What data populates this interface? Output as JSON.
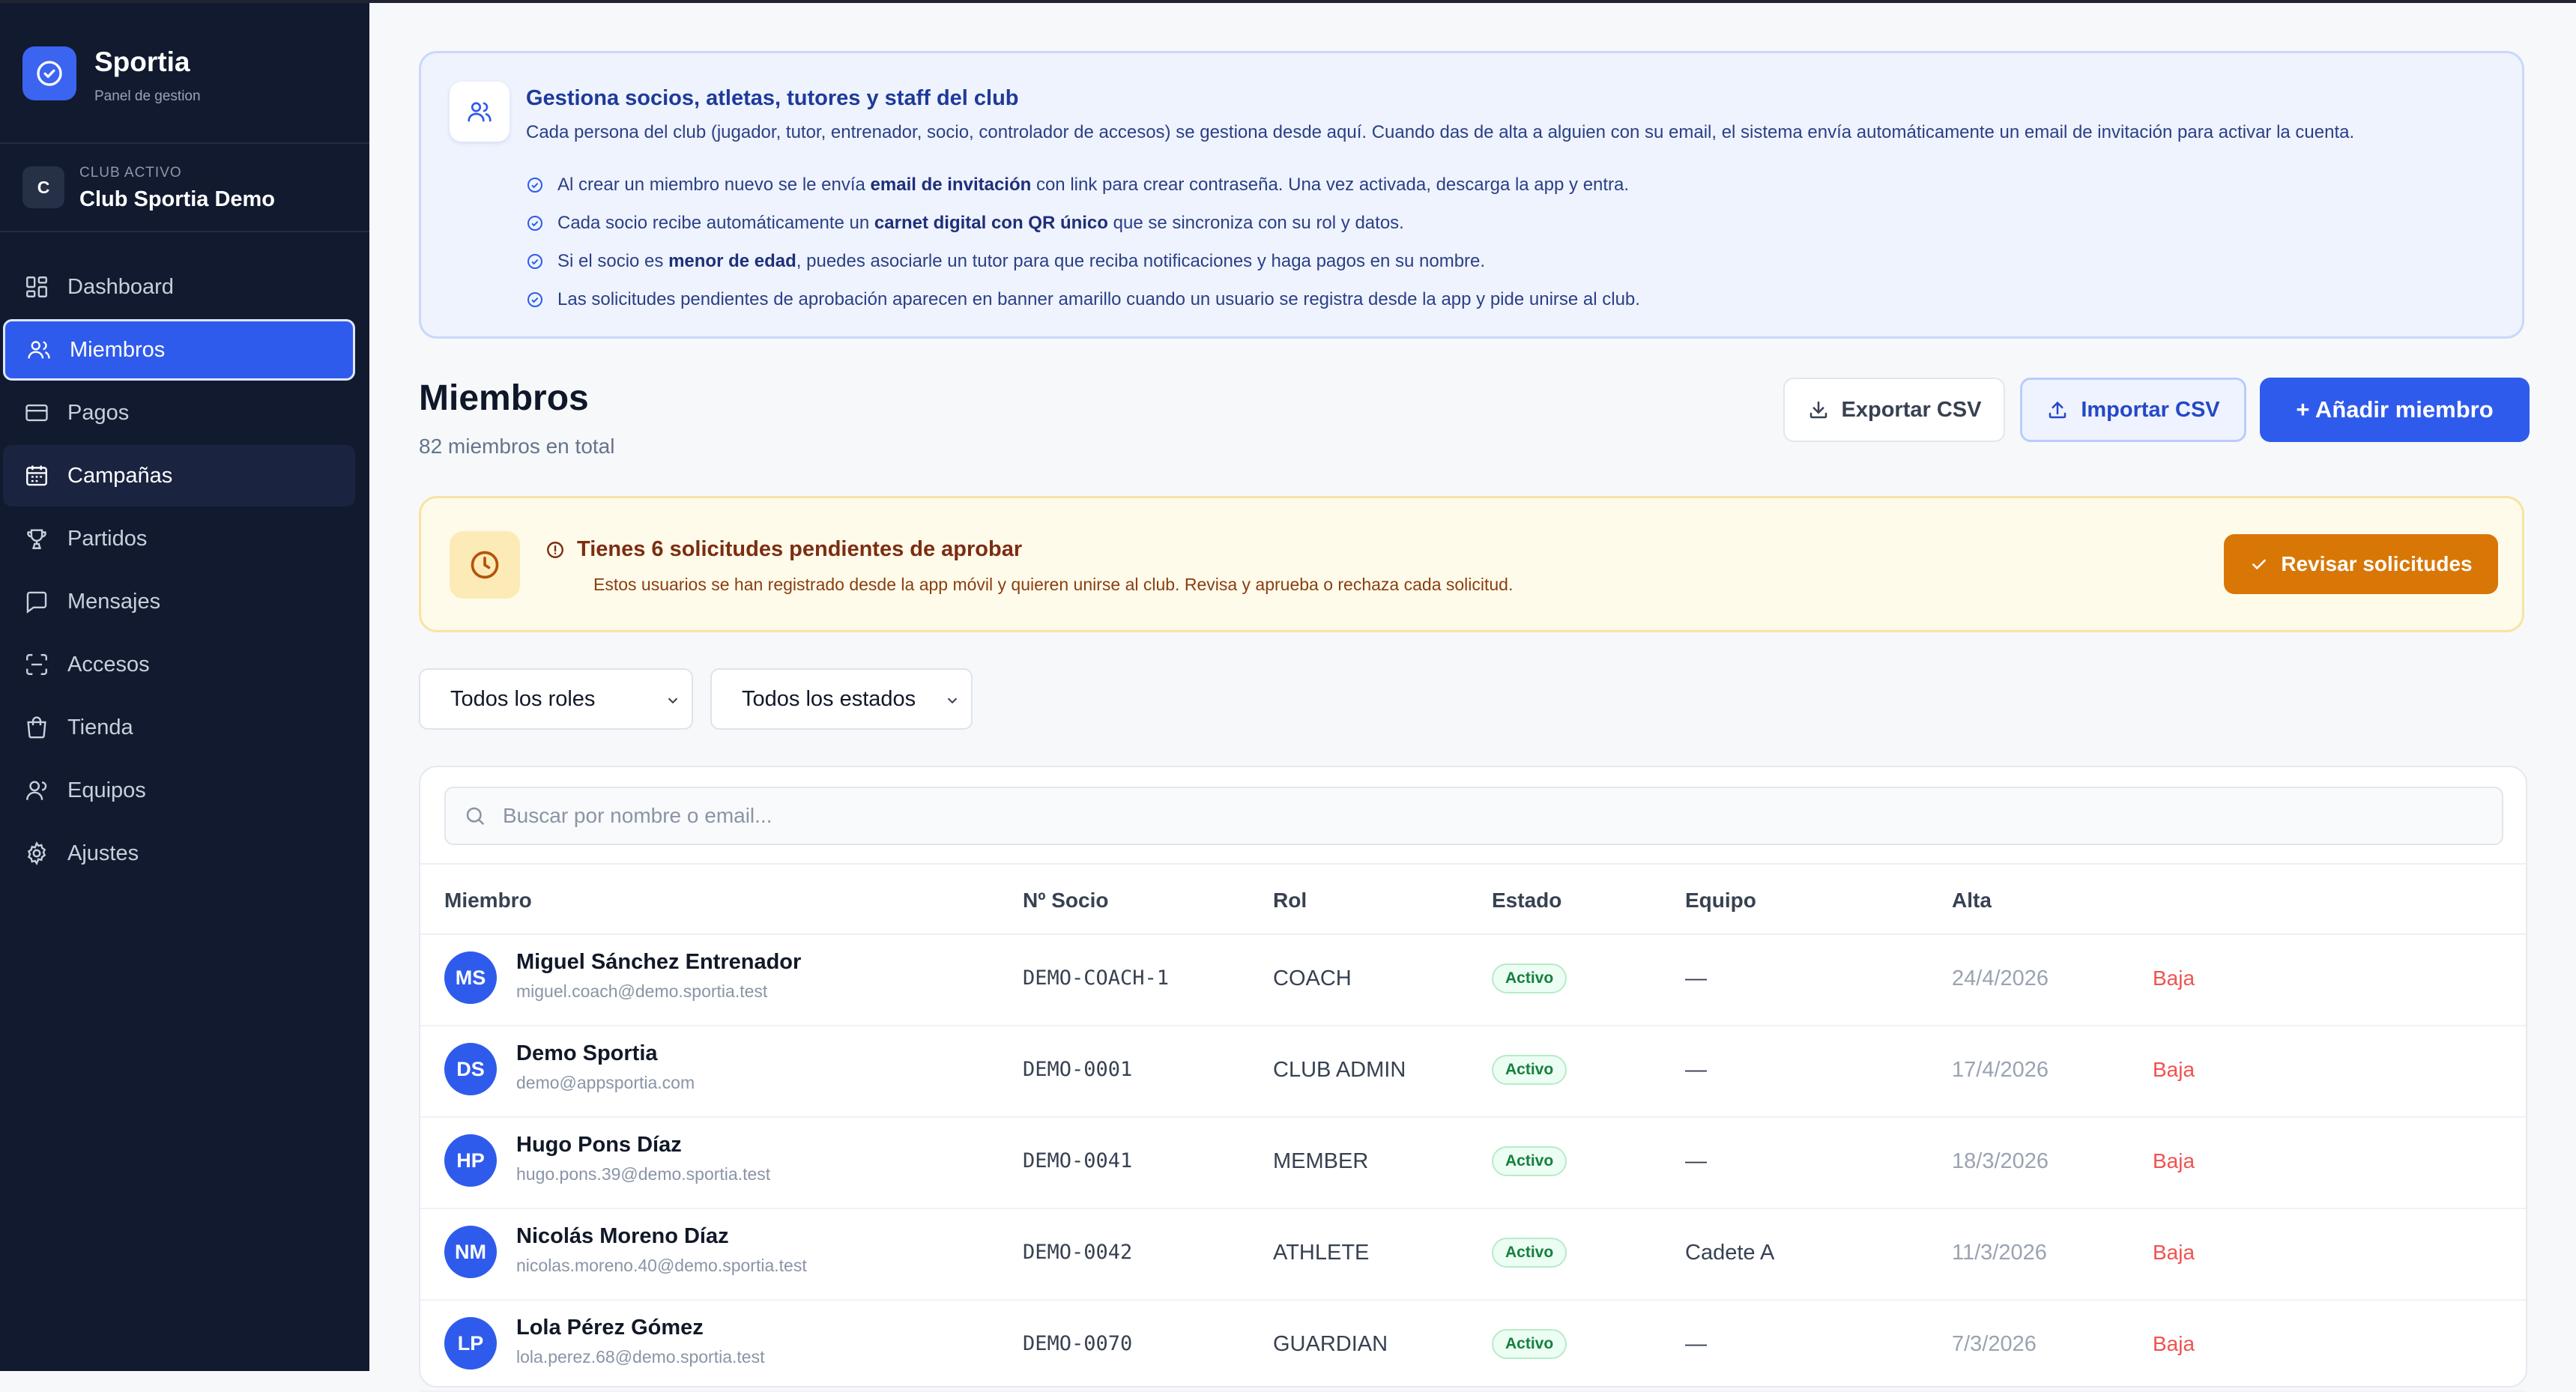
{
  "sidebar": {
    "brand": {
      "name": "Sportia",
      "subtitle": "Panel de gestion"
    },
    "club": {
      "badge": "C",
      "label": "CLUB ACTIVO",
      "name": "Club Sportia Demo"
    },
    "items": [
      {
        "label": "Dashboard",
        "icon": "dashboard-icon",
        "state": "normal"
      },
      {
        "label": "Miembros",
        "icon": "users-icon",
        "state": "active"
      },
      {
        "label": "Pagos",
        "icon": "credit-card-icon",
        "state": "normal"
      },
      {
        "label": "Campañas",
        "icon": "calendar-icon",
        "state": "hover"
      },
      {
        "label": "Partidos",
        "icon": "trophy-icon",
        "state": "normal"
      },
      {
        "label": "Mensajes",
        "icon": "message-icon",
        "state": "normal"
      },
      {
        "label": "Accesos",
        "icon": "scan-icon",
        "state": "normal"
      },
      {
        "label": "Tienda",
        "icon": "shopping-bag-icon",
        "state": "normal"
      },
      {
        "label": "Equipos",
        "icon": "user-icon",
        "state": "normal"
      },
      {
        "label": "Ajustes",
        "icon": "gear-icon",
        "state": "normal"
      }
    ]
  },
  "info": {
    "title": "Gestiona socios, atletas, tutores y staff del club",
    "description": "Cada persona del club (jugador, tutor, entrenador, socio, controlador de accesos) se gestiona desde aquí. Cuando das de alta a alguien con su email, el sistema envía automáticamente un email de invitación para activar la cuenta.",
    "items": [
      {
        "before": "Al crear un miembro nuevo se le envía ",
        "bold": "email de invitación",
        "after": " con link para crear contraseña. Una vez activada, descarga la app y entra."
      },
      {
        "before": "Cada socio recibe automáticamente un ",
        "bold": "carnet digital con QR único",
        "after": " que se sincroniza con su rol y datos."
      },
      {
        "before": "Si el socio es ",
        "bold": "menor de edad",
        "after": ", puedes asociarle un tutor para que reciba notificaciones y haga pagos en su nombre."
      },
      {
        "before": "Las solicitudes pendientes de aprobación aparecen en banner amarillo cuando un usuario se registra desde la app y pide unirse al club.",
        "bold": "",
        "after": ""
      }
    ]
  },
  "header": {
    "title": "Miembros",
    "subtitle": "82 miembros en total",
    "export_label": "Exportar CSV",
    "import_label": "Importar CSV",
    "add_label": "+ Añadir miembro"
  },
  "pending": {
    "title": "Tienes 6 solicitudes pendientes de aprobar",
    "description": "Estos usuarios se han registrado desde la app móvil y quieren unirse al club. Revisa y aprueba o rechaza cada solicitud.",
    "button_label": "Revisar solicitudes"
  },
  "filters": {
    "roles": "Todos los roles",
    "states": "Todos los estados"
  },
  "search": {
    "placeholder": "Buscar por nombre o email..."
  },
  "table": {
    "columns": [
      "Miembro",
      "Nº Socio",
      "Rol",
      "Estado",
      "Equipo",
      "Alta"
    ],
    "rows": [
      {
        "initials": "MS",
        "name": "Miguel Sánchez Entrenador",
        "email": "miguel.coach@demo.sportia.test",
        "number": "DEMO-COACH-1",
        "role": "COACH",
        "status": "Activo",
        "team": "—",
        "date": "24/4/2026",
        "action": "Baja"
      },
      {
        "initials": "DS",
        "name": "Demo Sportia",
        "email": "demo@appsportia.com",
        "number": "DEMO-0001",
        "role": "CLUB ADMIN",
        "status": "Activo",
        "team": "—",
        "date": "17/4/2026",
        "action": "Baja"
      },
      {
        "initials": "HP",
        "name": "Hugo Pons Díaz",
        "email": "hugo.pons.39@demo.sportia.test",
        "number": "DEMO-0041",
        "role": "MEMBER",
        "status": "Activo",
        "team": "—",
        "date": "18/3/2026",
        "action": "Baja"
      },
      {
        "initials": "NM",
        "name": "Nicolás Moreno Díaz",
        "email": "nicolas.moreno.40@demo.sportia.test",
        "number": "DEMO-0042",
        "role": "ATHLETE",
        "status": "Activo",
        "team": "Cadete A",
        "date": "11/3/2026",
        "action": "Baja"
      },
      {
        "initials": "LP",
        "name": "Lola Pérez Gómez",
        "email": "lola.perez.68@demo.sportia.test",
        "number": "DEMO-0070",
        "role": "GUARDIAN",
        "status": "Activo",
        "team": "—",
        "date": "7/3/2026",
        "action": "Baja"
      }
    ]
  },
  "colors": {
    "sidebar_bg": "#111a2e",
    "accent": "#2f5bec",
    "warning": "#d97706",
    "danger": "#ef5350",
    "success": "#15803d"
  }
}
